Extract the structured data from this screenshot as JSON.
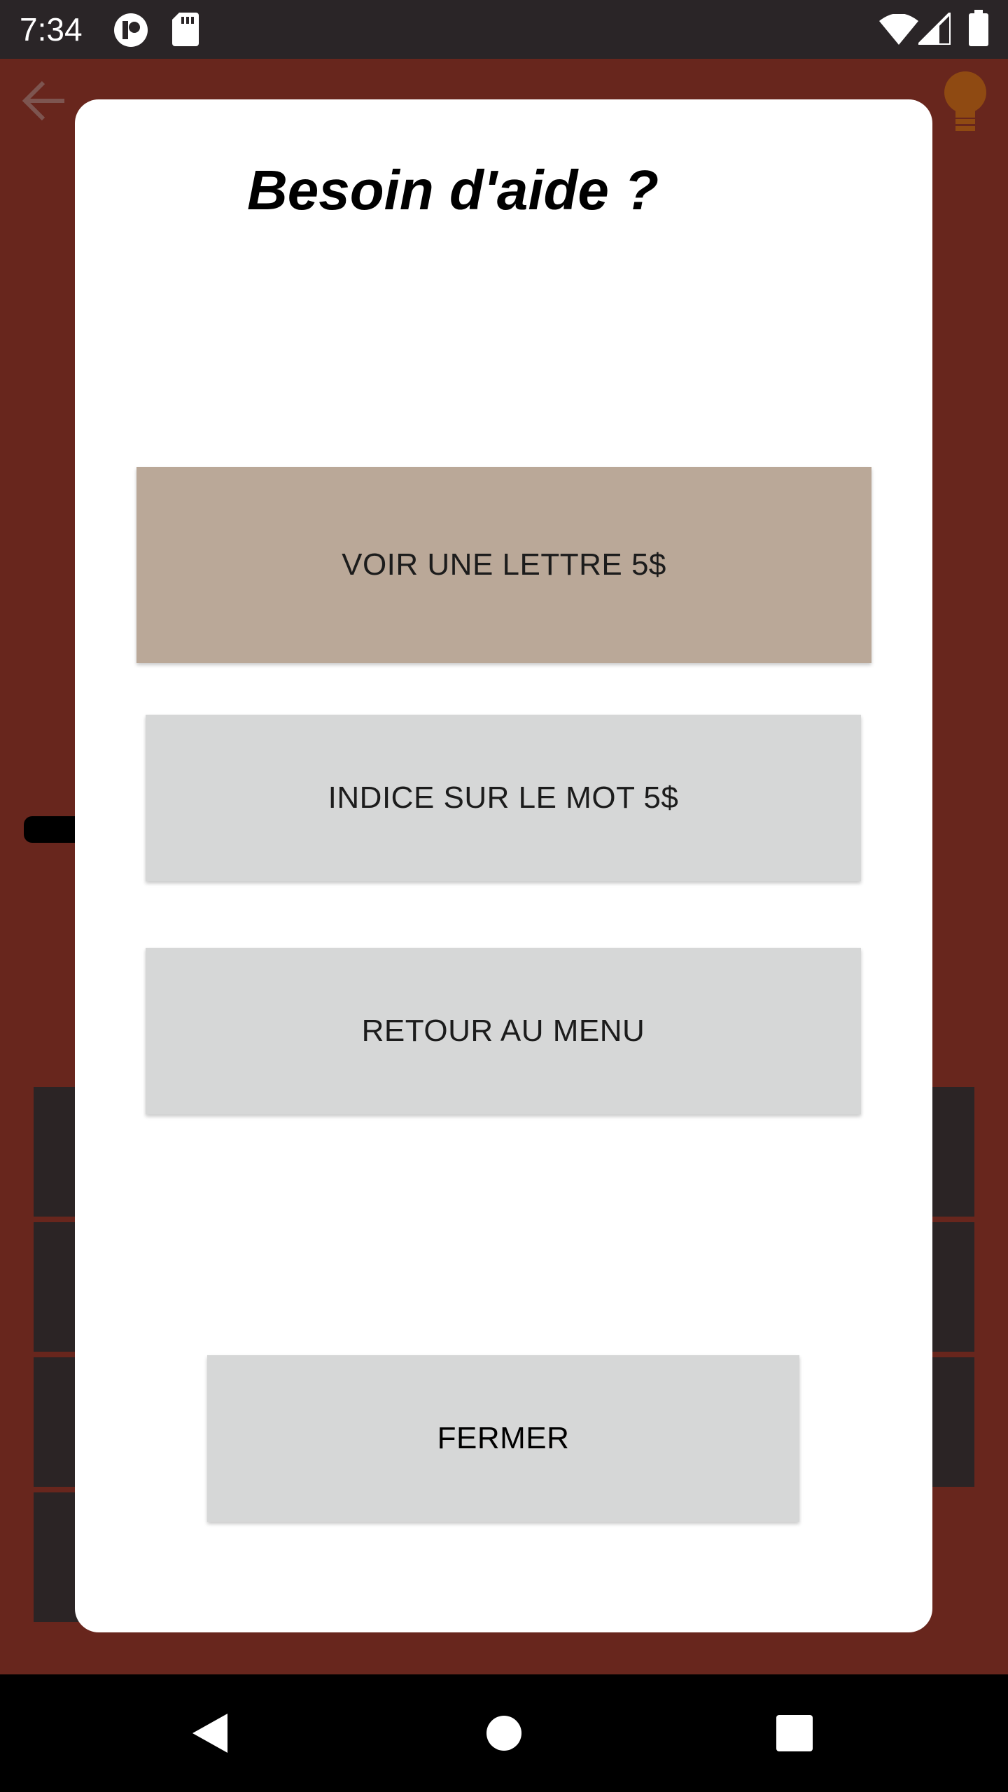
{
  "status_bar": {
    "time": "7:34",
    "icons": [
      "notification-app-icon",
      "sd-card-icon",
      "wifi-icon",
      "cell-signal-icon",
      "battery-icon"
    ]
  },
  "background": {
    "back_icon": "arrow-left-icon",
    "hint_icon": "lightbulb-icon",
    "accent_color": "#68261d"
  },
  "dialog": {
    "title": "Besoin d'aide ?",
    "buttons": {
      "reveal_letter": "VOIR UNE LETTRE 5$",
      "word_hint": "INDICE SUR LE MOT 5$",
      "back_to_menu": "RETOUR AU MENU",
      "close": "FERMER"
    },
    "colors": {
      "primary_button": "#baa898",
      "secondary_button": "#d6d7d7"
    }
  },
  "nav_bar": {
    "icons": [
      "back-triangle-icon",
      "home-circle-icon",
      "recents-square-icon"
    ]
  }
}
